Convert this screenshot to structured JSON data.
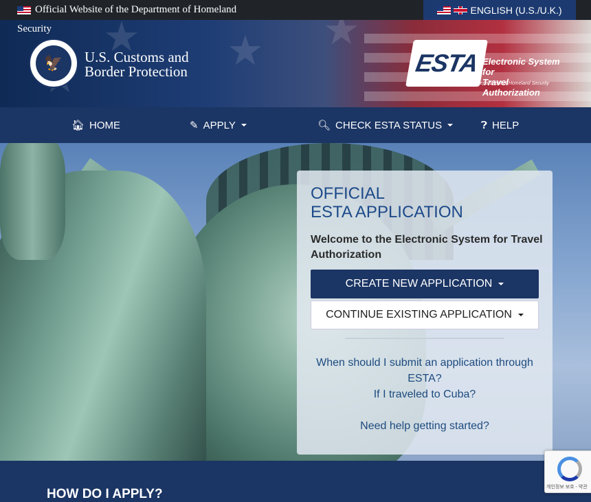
{
  "gov_banner": {
    "line1": "Official Website of the Department of Homeland",
    "line2": "Security"
  },
  "language": {
    "label": "ENGLISH (U.S./U.K.)"
  },
  "agency": {
    "line1": "U.S. Customs and",
    "line2": "Border Protection"
  },
  "esta_logo": {
    "word": "ESTA",
    "tagline1": "Electronic System for",
    "tagline2": "Travel Authorization",
    "dept": "U.S. Department of Homeland Security"
  },
  "nav": {
    "home": "HOME",
    "apply": "APPLY",
    "status": "CHECK ESTA STATUS",
    "help": "HELP"
  },
  "card": {
    "title_line1": "OFFICIAL",
    "title_line2": "ESTA APPLICATION",
    "welcome": "Welcome to the Electronic System for Travel Authorization",
    "create_button": "CREATE NEW APPLICATION",
    "continue_button": "CONTINUE EXISTING APPLICATION",
    "link_when": "When should I submit an application through ESTA?",
    "link_cuba": "If I traveled to Cuba?",
    "link_help": "Need help getting started?"
  },
  "bottom": {
    "heading": "HOW DO I APPLY?"
  },
  "recaptcha": {
    "text": "개인정보 보호 - 약관"
  },
  "colors": {
    "navy": "#1b3564",
    "topbar": "#202429",
    "link": "#1d4a7e"
  }
}
